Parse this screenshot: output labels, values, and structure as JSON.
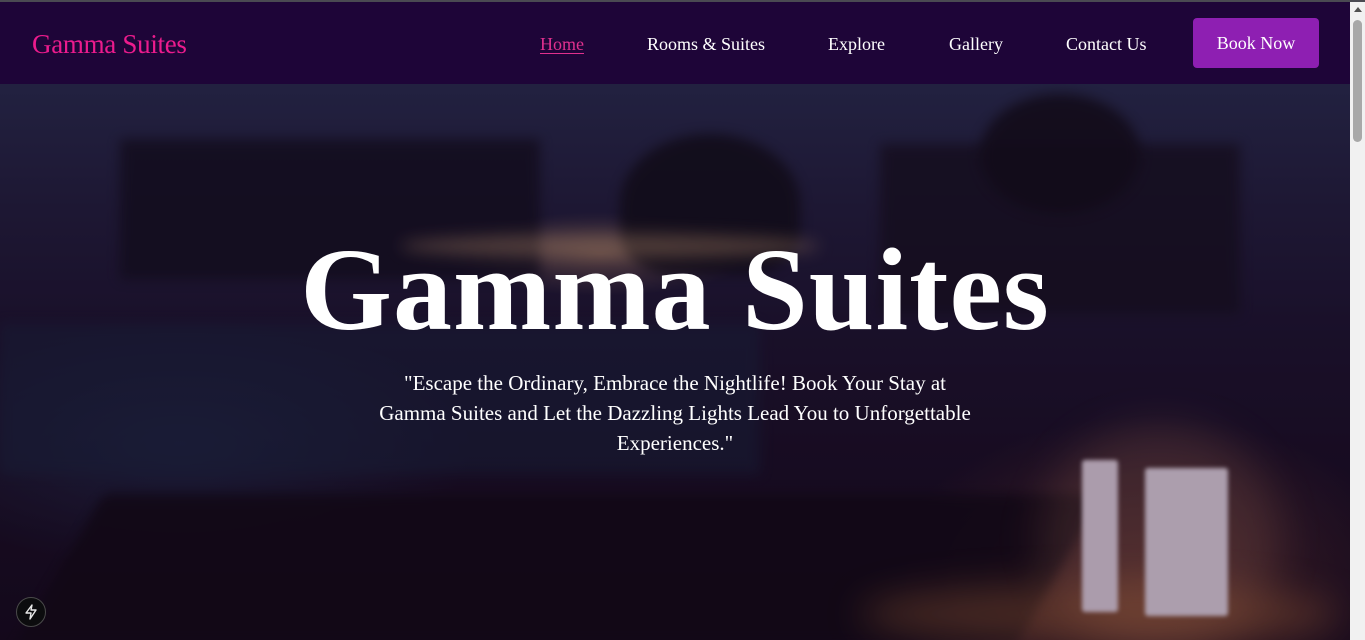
{
  "header": {
    "brand": "Gamma Suites",
    "nav": [
      {
        "label": "Home",
        "active": true
      },
      {
        "label": "Rooms & Suites",
        "active": false
      },
      {
        "label": "Explore",
        "active": false
      },
      {
        "label": "Gallery",
        "active": false
      },
      {
        "label": "Contact Us",
        "active": false
      }
    ],
    "cta_label": "Book Now"
  },
  "hero": {
    "title": "Gamma Suites",
    "tagline": "\"Escape the Ordinary, Embrace the Nightlife! Book Your Stay at Gamma Suites and Let the Dazzling Lights Lead You to Unforgettable Experiences.\"",
    "background": "blurred-night-resort-photo"
  },
  "dev_indicator": {
    "icon": "lightning-bolt-icon"
  },
  "colors": {
    "navbar_bg": "#1e0538",
    "brand": "#ec1b8d",
    "active_link": "#e0308e",
    "cta_bg": "#8e1fb2",
    "text": "#ffffff"
  }
}
